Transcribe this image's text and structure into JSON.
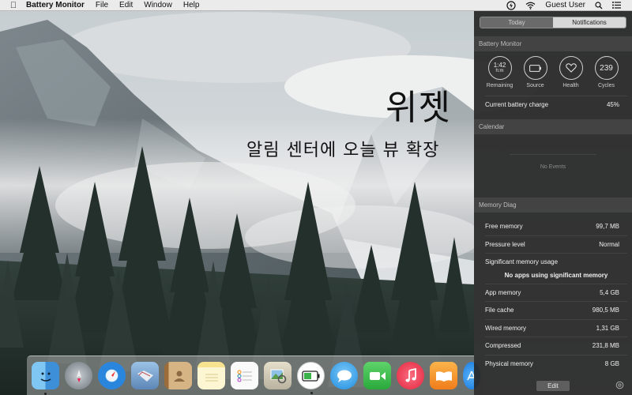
{
  "menubar": {
    "app_name": "Battery Monitor",
    "menus": [
      "File",
      "Edit",
      "Window",
      "Help"
    ],
    "user": "Guest User"
  },
  "overlay": {
    "title": "위젯",
    "subtitle": "알림 센터에 오늘 뷰 확장"
  },
  "notification_center": {
    "tabs": {
      "today": "Today",
      "notifications": "Notifications"
    },
    "battery_monitor": {
      "header": "Battery Monitor",
      "gauges": [
        {
          "value": "1:42",
          "sub": "h:m",
          "label": "Remaining",
          "icon": "time"
        },
        {
          "value": "",
          "sub": "",
          "label": "Source",
          "icon": "battery-icon"
        },
        {
          "value": "",
          "sub": "",
          "label": "Health",
          "icon": "heart-icon"
        },
        {
          "value": "239",
          "sub": "",
          "label": "Cycles",
          "icon": "cycles"
        }
      ],
      "charge_label": "Current battery charge",
      "charge_value": "45%"
    },
    "calendar": {
      "header": "Calendar",
      "empty": "No Events"
    },
    "memory_diag": {
      "header": "Memory Diag",
      "free_memory_label": "Free memory",
      "free_memory_value": "99,7 MB",
      "pressure_label": "Pressure level",
      "pressure_value": "Normal",
      "significant_label": "Significant memory usage",
      "significant_value": "No apps using significant memory",
      "app_memory_label": "App memory",
      "app_memory_value": "5,4 GB",
      "file_cache_label": "File cache",
      "file_cache_value": "980,5 MB",
      "wired_label": "Wired memory",
      "wired_value": "1,31 GB",
      "compressed_label": "Compressed",
      "compressed_value": "231,8 MB",
      "physical_label": "Physical memory",
      "physical_value": "8 GB"
    },
    "footer": {
      "edit": "Edit"
    }
  },
  "dock": {
    "apps": [
      {
        "name": "finder-icon",
        "color": "#4aa3e8"
      },
      {
        "name": "launchpad-icon",
        "color": "#9aa4ad"
      },
      {
        "name": "safari-icon",
        "color": "#2e8fe0"
      },
      {
        "name": "mail-icon",
        "color": "#7f9fc6"
      },
      {
        "name": "contacts-icon",
        "color": "#c79a5c"
      },
      {
        "name": "notes-icon",
        "color": "#f3d77a"
      },
      {
        "name": "reminders-icon",
        "color": "#f6f6f6"
      },
      {
        "name": "preview-icon",
        "color": "#d9d3c0"
      },
      {
        "name": "battery-monitor-icon",
        "color": "#f1f1f1"
      },
      {
        "name": "messages-icon",
        "color": "#48aef1"
      },
      {
        "name": "facetime-icon",
        "color": "#3fc14e"
      },
      {
        "name": "itunes-icon",
        "color": "#f14b63"
      },
      {
        "name": "ibooks-icon",
        "color": "#f39a2a"
      },
      {
        "name": "app-store-icon",
        "color": "#2d8ff0"
      }
    ]
  }
}
